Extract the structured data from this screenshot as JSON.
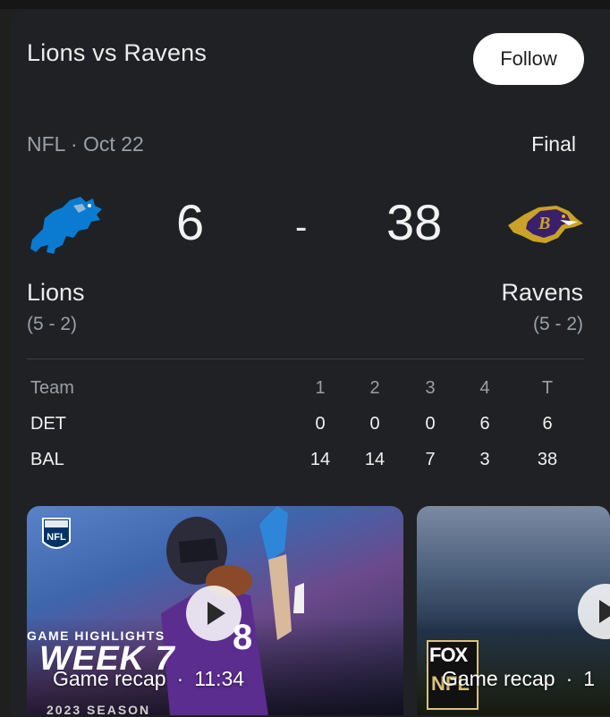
{
  "header": {
    "title": "Lions vs Ravens",
    "follow_label": "Follow"
  },
  "game": {
    "league_date": "NFL · Oct 22",
    "status": "Final"
  },
  "home": {
    "name": "Lions",
    "record": "(5 - 2)",
    "score": "6",
    "abbr": "DET",
    "color": "#0076b6",
    "icon": "lions-logo-icon"
  },
  "away": {
    "name": "Ravens",
    "record": "(5 - 2)",
    "score": "38",
    "abbr": "BAL",
    "color": "#9e7c0c",
    "icon": "ravens-logo-icon"
  },
  "score_separator": "-",
  "boxscore": {
    "headers": [
      "Team",
      "1",
      "2",
      "3",
      "4",
      "T"
    ],
    "rows": [
      {
        "team": "DET",
        "q": [
          "0",
          "0",
          "0",
          "6",
          "6"
        ]
      },
      {
        "team": "BAL",
        "q": [
          "14",
          "14",
          "7",
          "3",
          "38"
        ]
      }
    ]
  },
  "videos": [
    {
      "caption": "Game recap",
      "duration": "11:34",
      "overlay_top": "GAME HIGHLIGHTS",
      "overlay_main": "WEEK 7",
      "overlay_bottom": "2023 SEASON"
    },
    {
      "caption": "Game recap",
      "duration": "1",
      "network_top": "FOX",
      "network_bottom": "NFL"
    }
  ]
}
